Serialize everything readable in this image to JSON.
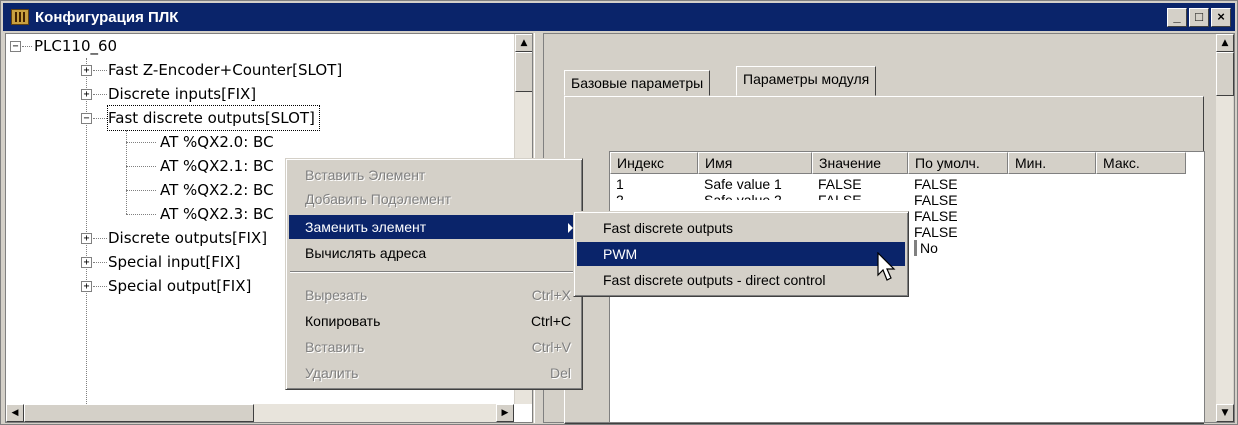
{
  "window": {
    "title": "Конфигурация ПЛК",
    "buttons": {
      "minimize": "_",
      "maximize": "□",
      "close": "×"
    }
  },
  "tree": {
    "root": "PLC110_60",
    "items": [
      {
        "label": "Fast Z-Encoder+Counter[SLOT]",
        "expander": "+"
      },
      {
        "label": "Discrete inputs[FIX]",
        "expander": "+"
      },
      {
        "label": "Fast discrete outputs[SLOT]",
        "expander": "−"
      },
      {
        "label": "AT %QX2.0: BC"
      },
      {
        "label": "AT %QX2.1: BC"
      },
      {
        "label": "AT %QX2.2: BC"
      },
      {
        "label": "AT %QX2.3: BC"
      },
      {
        "label": "Discrete outputs[FIX]",
        "expander": "+"
      },
      {
        "label": "Special input[FIX]",
        "expander": "+"
      },
      {
        "label": "Special output[FIX]",
        "expander": "+"
      }
    ]
  },
  "tabs": [
    "Базовые параметры",
    "Параметры модуля"
  ],
  "grid": {
    "columns": [
      "Индекс",
      "Имя",
      "Значение",
      "По умолч.",
      "Мин.",
      "Макс."
    ],
    "rows": [
      {
        "index": "1",
        "name": "Safe value 1",
        "value": "FALSE",
        "default": "FALSE"
      },
      {
        "index": "2",
        "name": "Safe value 2",
        "value": "FALSE",
        "default": "FALSE"
      },
      {
        "default": "FALSE"
      },
      {
        "default": "FALSE"
      },
      {
        "default": "No"
      }
    ]
  },
  "context_menu": {
    "items": [
      {
        "label": "Вставить Элемент",
        "shortcut": "",
        "enabled": false
      },
      {
        "label": "Добавить Подэлемент",
        "shortcut": "",
        "enabled": false
      },
      {
        "label": "Заменить элемент",
        "shortcut": "",
        "enabled": true,
        "submenu": true
      },
      {
        "label": "Вычислять адреса",
        "shortcut": "",
        "enabled": true
      },
      {
        "label": "Вырезать",
        "shortcut": "Ctrl+X",
        "enabled": false
      },
      {
        "label": "Копировать",
        "shortcut": "Ctrl+C",
        "enabled": true
      },
      {
        "label": "Вставить",
        "shortcut": "Ctrl+V",
        "enabled": false
      },
      {
        "label": "Удалить",
        "shortcut": "Del",
        "enabled": false
      }
    ]
  },
  "submenu": {
    "items": [
      "Fast discrete outputs",
      "PWM",
      "Fast discrete outputs - direct control"
    ]
  },
  "colors": {
    "title_bar": "#0a246a",
    "face": "#d4d0c8",
    "highlight": "#0a246a"
  }
}
